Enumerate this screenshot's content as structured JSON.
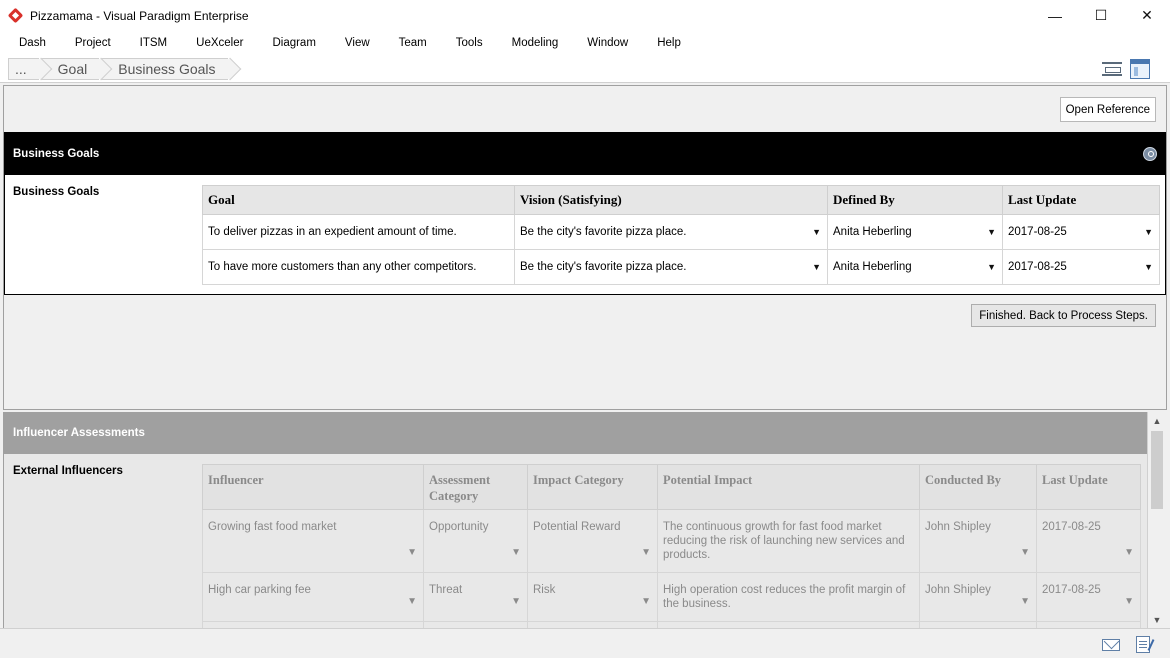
{
  "window": {
    "title": "Pizzamama - Visual Paradigm Enterprise",
    "controls": {
      "minimize": "—",
      "maximize": "☐",
      "close": "✕"
    }
  },
  "menu": [
    "Dash",
    "Project",
    "ITSM",
    "UeXceler",
    "Diagram",
    "View",
    "Team",
    "Tools",
    "Modeling",
    "Window",
    "Help"
  ],
  "breadcrumb": [
    "...",
    "Goal",
    "Business Goals"
  ],
  "toolbar": {
    "open_reference": "Open Reference",
    "finished": "Finished. Back to Process Steps."
  },
  "business_goals": {
    "header": "Business Goals",
    "side_label": "Business Goals",
    "columns": [
      "Goal",
      "Vision (Satisfying)",
      "Defined By",
      "Last Update"
    ],
    "rows": [
      [
        "To deliver pizzas in an expedient amount of time.",
        "Be the city's favorite pizza place.",
        "Anita Heberling",
        "2017-08-25"
      ],
      [
        "To have more customers than any other competitors.",
        "Be the city's favorite pizza place.",
        "Anita Heberling",
        "2017-08-25"
      ]
    ]
  },
  "influencer": {
    "header": "Influencer Assessments",
    "side_label": "External Influencers",
    "columns": [
      "Influencer",
      "Assessment Category",
      "Impact Category",
      "Potential Impact",
      "Conducted By",
      "Last Update"
    ],
    "rows": [
      [
        "Growing fast food market",
        "Opportunity",
        "Potential Reward",
        "The continuous growth for fast food market reducing the risk of launching new services and products.",
        "John Shipley",
        "2017-08-25"
      ],
      [
        "High car parking fee",
        "Threat",
        "Risk",
        "High operation cost reduces the profit margin of the business.",
        "John Shipley",
        "2017-08-25"
      ]
    ]
  },
  "icons": {
    "dropdown": "▼",
    "scroll_up": "▲",
    "scroll_down": "▼"
  }
}
